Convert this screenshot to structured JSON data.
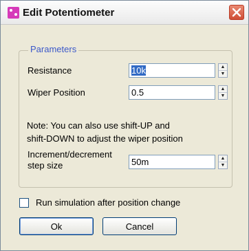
{
  "window": {
    "title": "Edit Potentiometer",
    "close_label": "close"
  },
  "group": {
    "label": "Parameters"
  },
  "fields": {
    "resistance": {
      "label": "Resistance",
      "value": "10k"
    },
    "wiper": {
      "label": "Wiper Position",
      "value": "0.5"
    },
    "increment": {
      "label_line1": "Increment/decrement",
      "label_line2": "step size",
      "value": "50m"
    }
  },
  "note": {
    "line1": "Note: You can also use shift-UP and",
    "line2": "shift-DOWN to adjust the wiper position"
  },
  "checkbox": {
    "label": "Run simulation after position change",
    "checked": false
  },
  "buttons": {
    "ok": "Ok",
    "cancel": "Cancel"
  },
  "colors": {
    "accent": "#3c59c9",
    "selection": "#316ac5",
    "app_icon": "#d63ab9",
    "close": "#cf4d35"
  },
  "icons": {
    "app": "component-icon",
    "close": "close-icon",
    "spin_up": "spin-up-arrow",
    "spin_down": "spin-down-arrow"
  }
}
